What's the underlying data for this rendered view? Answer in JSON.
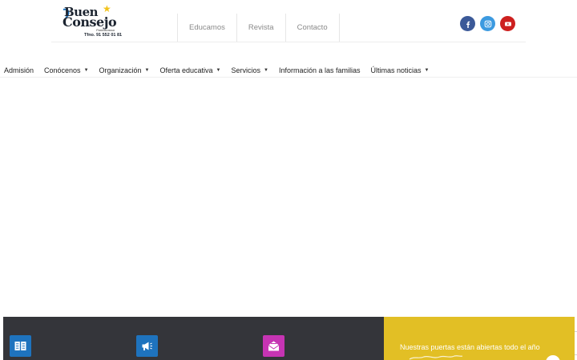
{
  "logo": {
    "word1": "Buen",
    "word2": "Consejo",
    "tagline": "Parbuscasso",
    "phone": "Tfno. 91 552 01 81"
  },
  "topnav": [
    "Educamos",
    "Revista",
    "Contacto"
  ],
  "social": [
    {
      "name": "facebook-icon",
      "color": "#3b5998"
    },
    {
      "name": "instagram-icon",
      "color": "#3c9ae0"
    },
    {
      "name": "youtube-icon",
      "color": "#cd201f"
    }
  ],
  "mainmenu": [
    {
      "label": "Admisión",
      "dropdown": false
    },
    {
      "label": "Conócenos",
      "dropdown": true
    },
    {
      "label": "Organización",
      "dropdown": true
    },
    {
      "label": "Oferta educativa",
      "dropdown": true
    },
    {
      "label": "Servicios",
      "dropdown": true
    },
    {
      "label": "Información a las familias",
      "dropdown": false
    },
    {
      "label": "Últimas noticias",
      "dropdown": true
    }
  ],
  "footer": {
    "icons": [
      {
        "name": "book-icon",
        "color": "#1e73be"
      },
      {
        "name": "megaphone-icon",
        "color": "#1e73be"
      },
      {
        "name": "envelope-icon",
        "color": "#c634b3"
      }
    ],
    "text": "Nuestras puertas están abiertas todo el año",
    "dark_color": "#34353a",
    "accent_color": "#e2bf25"
  }
}
